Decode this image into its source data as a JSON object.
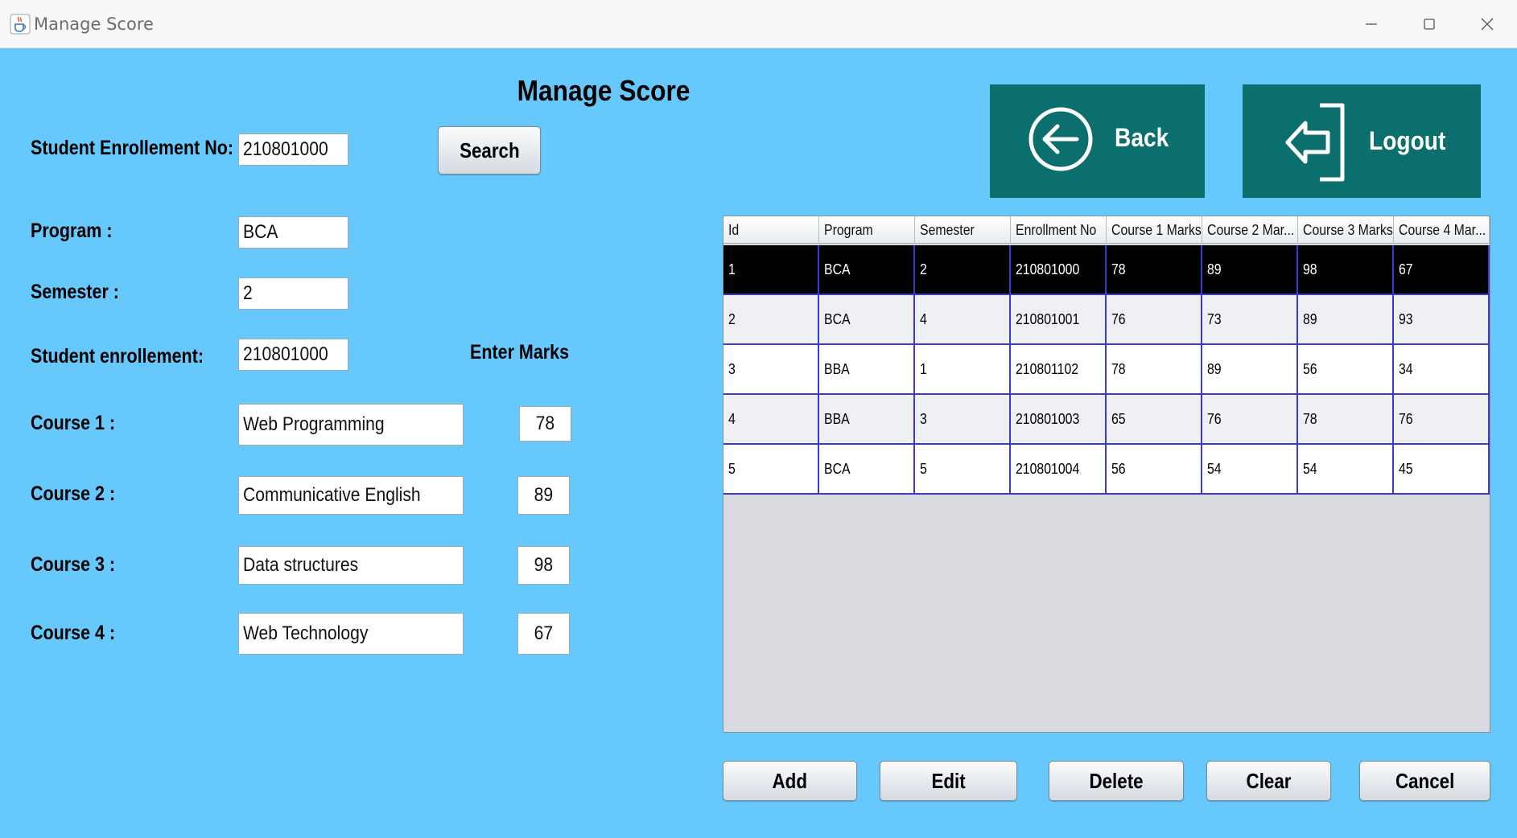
{
  "window": {
    "title": "Manage Score"
  },
  "page": {
    "heading": "Manage Score"
  },
  "search": {
    "label": "Student Enrollement No:",
    "value": "210801000",
    "button": "Search"
  },
  "form": {
    "program_label": "Program :",
    "program_value": "BCA",
    "semester_label": "Semester :",
    "semester_value": "2",
    "enrollment_label": "Student enrollement:",
    "enrollment_value": "210801000",
    "enter_marks_label": "Enter Marks",
    "courses": [
      {
        "label": "Course 1 :",
        "name": "Web Programming",
        "marks": "78"
      },
      {
        "label": "Course 2 :",
        "name": "Communicative English",
        "marks": "89"
      },
      {
        "label": "Course 3 :",
        "name": "Data structures",
        "marks": "98"
      },
      {
        "label": "Course 4 :",
        "name": "Web Technology",
        "marks": "67"
      }
    ]
  },
  "nav": {
    "back_label": "Back",
    "logout_label": "Logout"
  },
  "table": {
    "columns": [
      "Id",
      "Program",
      "Semester",
      "Enrollment No",
      "Course 1 Marks",
      "Course 2 Mar...",
      "Course 3 Marks",
      "Course 4 Mar..."
    ],
    "rows": [
      [
        "1",
        "BCA",
        "2",
        "210801000",
        "78",
        "89",
        "98",
        "67"
      ],
      [
        "2",
        "BCA",
        "4",
        "210801001",
        "76",
        "73",
        "89",
        "93"
      ],
      [
        "3",
        "BBA",
        "1",
        "210801102",
        "78",
        "89",
        "56",
        "34"
      ],
      [
        "4",
        "BBA",
        "3",
        "210801003",
        "65",
        "76",
        "78",
        "76"
      ],
      [
        "5",
        "BCA",
        "5",
        "210801004",
        "56",
        "54",
        "54",
        "45"
      ]
    ],
    "selected_row": 0
  },
  "actions": {
    "add": "Add",
    "edit": "Edit",
    "delete": "Delete",
    "clear": "Clear",
    "cancel": "Cancel"
  },
  "colors": {
    "panel_bg": "#66c8fb",
    "nav_button_bg": "#0b6f6e",
    "row_border": "#3a3ad0",
    "selected_row_bg": "#000000"
  },
  "icons": {
    "app": "java-cup-icon",
    "back": "circle-arrow-left-icon",
    "logout": "logout-door-arrow-icon"
  }
}
